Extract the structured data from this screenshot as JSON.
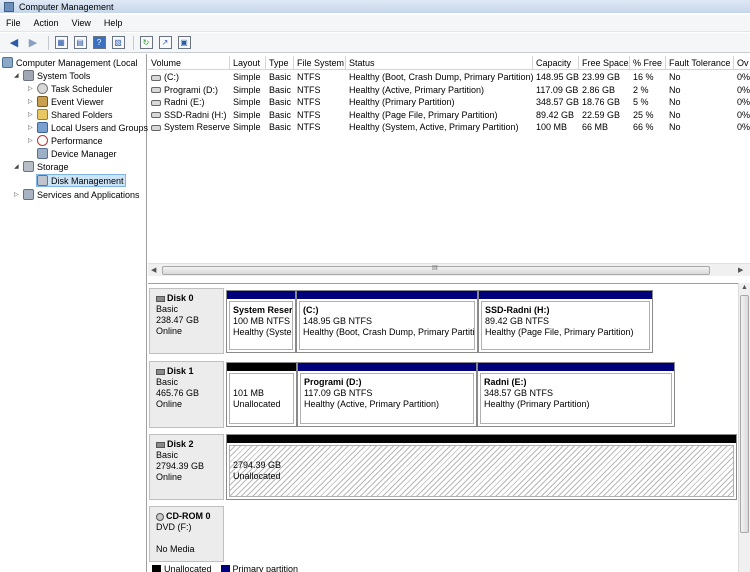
{
  "window": {
    "title": "Computer Management"
  },
  "menu": [
    "File",
    "Action",
    "View",
    "Help"
  ],
  "tree": {
    "root": "Computer Management (Local",
    "system_tools": "System Tools",
    "task_scheduler": "Task Scheduler",
    "event_viewer": "Event Viewer",
    "shared_folders": "Shared Folders",
    "local_users": "Local Users and Groups",
    "performance": "Performance",
    "device_manager": "Device Manager",
    "storage": "Storage",
    "disk_management": "Disk Management",
    "services": "Services and Applications"
  },
  "volume_list": {
    "columns": [
      "Volume",
      "Layout",
      "Type",
      "File System",
      "Status",
      "Capacity",
      "Free Space",
      "% Free",
      "Fault Tolerance",
      "Ov"
    ],
    "rows": [
      [
        "(C:)",
        "Simple",
        "Basic",
        "NTFS",
        "Healthy (Boot, Crash Dump, Primary Partition)",
        "148.95 GB",
        "23.99 GB",
        "16 %",
        "No",
        "0%"
      ],
      [
        "Programi (D:)",
        "Simple",
        "Basic",
        "NTFS",
        "Healthy (Active, Primary Partition)",
        "117.09 GB",
        "2.86 GB",
        "2 %",
        "No",
        "0%"
      ],
      [
        "Radni (E:)",
        "Simple",
        "Basic",
        "NTFS",
        "Healthy (Primary Partition)",
        "348.57 GB",
        "18.76 GB",
        "5 %",
        "No",
        "0%"
      ],
      [
        "SSD-Radni (H:)",
        "Simple",
        "Basic",
        "NTFS",
        "Healthy (Page File, Primary Partition)",
        "89.42 GB",
        "22.59 GB",
        "25 %",
        "No",
        "0%"
      ],
      [
        "System Reserved",
        "Simple",
        "Basic",
        "NTFS",
        "Healthy (System, Active, Primary Partition)",
        "100 MB",
        "66 MB",
        "66 %",
        "No",
        "0%"
      ]
    ],
    "scroll_grip": "III"
  },
  "disks": {
    "disk0": {
      "name": "Disk 0",
      "type": "Basic",
      "size": "238.47 GB",
      "state": "Online",
      "partitions": [
        {
          "title": "System Reserv",
          "size": "100 MB NTFS",
          "status": "Healthy (Syster"
        },
        {
          "title": "(C:)",
          "size": "148.95 GB NTFS",
          "status": "Healthy (Boot, Crash Dump, Primary Partitio"
        },
        {
          "title": "SSD-Radni  (H:)",
          "size": "89.42 GB NTFS",
          "status": "Healthy (Page File, Primary Partition)"
        }
      ]
    },
    "disk1": {
      "name": "Disk 1",
      "type": "Basic",
      "size": "465.76 GB",
      "state": "Online",
      "partitions": [
        {
          "size": "101 MB",
          "status": "Unallocated"
        },
        {
          "title": "Programi  (D:)",
          "size": "117.09 GB NTFS",
          "status": "Healthy (Active, Primary Partition)"
        },
        {
          "title": "Radni  (E:)",
          "size": "348.57 GB NTFS",
          "status": "Healthy (Primary Partition)"
        }
      ]
    },
    "disk2": {
      "name": "Disk 2",
      "type": "Basic",
      "size": "2794.39 GB",
      "state": "Online",
      "partitions": [
        {
          "size": "2794.39 GB",
          "status": "Unallocated"
        }
      ]
    },
    "cdrom0": {
      "name": "CD-ROM 0",
      "type": "DVD (F:)",
      "state": "No Media"
    }
  },
  "legend": {
    "unallocated": "Unallocated",
    "primary": "Primary partition"
  },
  "colors": {
    "primary": "#00007c",
    "unallocated": "#000000",
    "selection": "#cde4f7"
  }
}
